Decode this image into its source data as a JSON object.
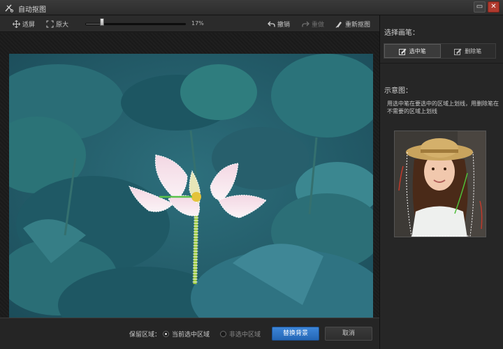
{
  "window": {
    "title": "自动抠图",
    "minimize_glyph": "▭",
    "close_glyph": "✕"
  },
  "toolbar": {
    "fit_label": "适屏",
    "enlarge_label": "原大",
    "zoom_text": "17%",
    "zoom_level": 0.17,
    "undo_label": "撤销",
    "redo_label": "重做",
    "reset_label": "重新抠图"
  },
  "panel": {
    "brush_heading": "选择画笔：",
    "select_brush_label": "选中笔",
    "delete_brush_label": "删除笔",
    "example_heading": "示意图：",
    "hint_text": "用选中笔在要选中的区域上划线，用删除笔在不需要的区域上划线"
  },
  "bottom": {
    "keep_label": "保留区域：",
    "option_current": "当前选中区域",
    "option_non_selected": "非选中区域",
    "replace_bg_label": "替换背景",
    "cancel_label": "取消"
  },
  "colors": {
    "accent": "#2f78cc",
    "background": "#1e1e1e",
    "panel": "#262626"
  }
}
